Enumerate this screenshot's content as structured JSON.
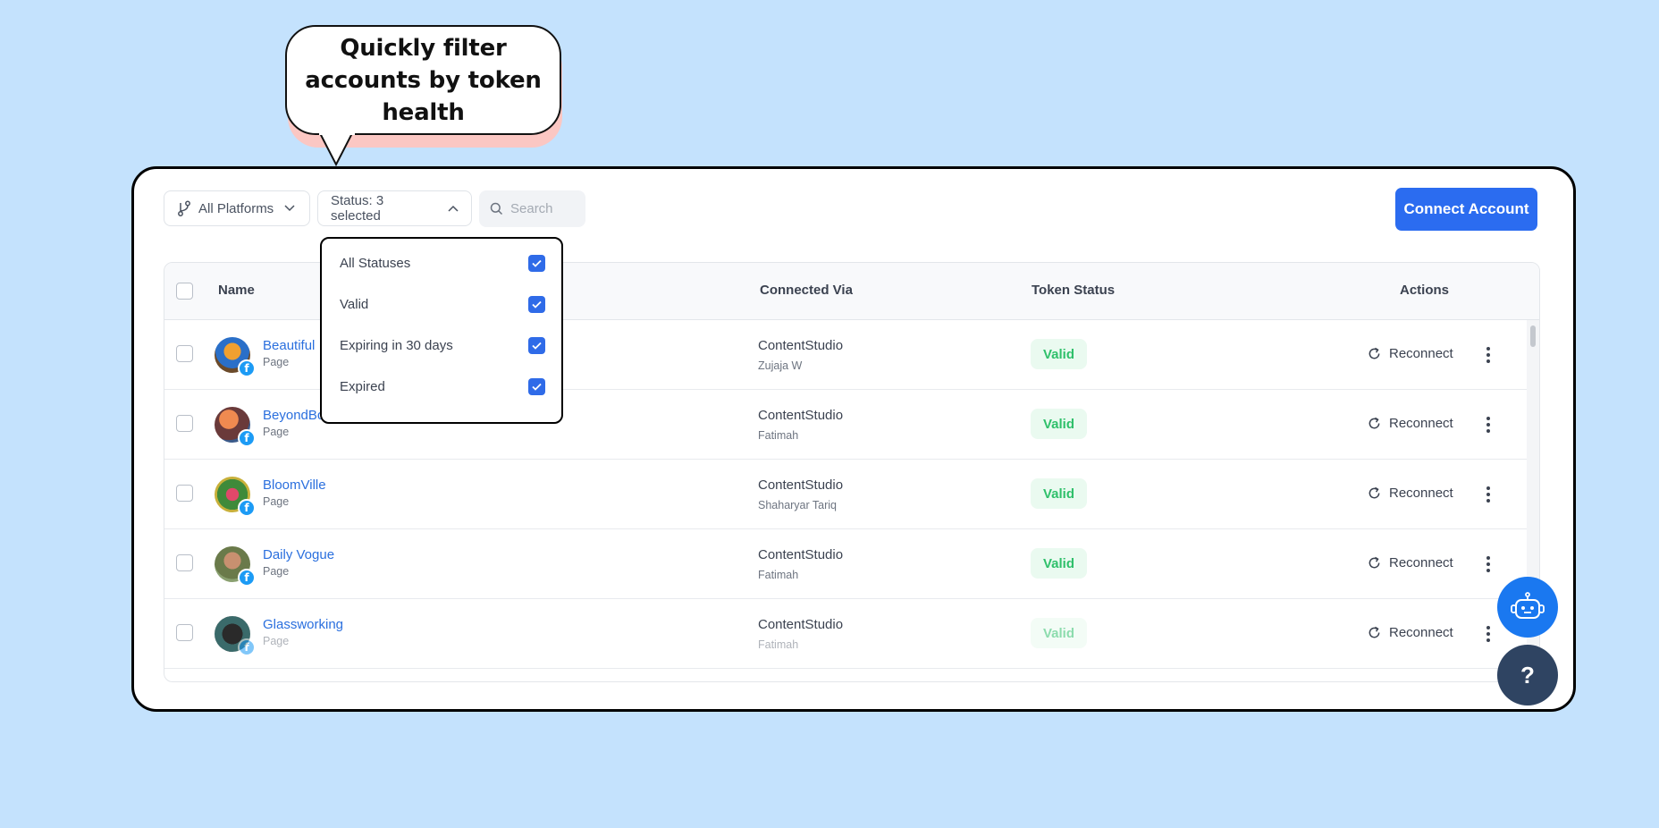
{
  "callout": {
    "text": "Quickly filter accounts by token health"
  },
  "toolbar": {
    "platforms_label": "All Platforms",
    "status_label": "Status: 3 selected",
    "search_placeholder": "Search",
    "connect_label": "Connect Account"
  },
  "status_dropdown": {
    "options": [
      {
        "label": "All Statuses",
        "checked": true
      },
      {
        "label": "Valid",
        "checked": true
      },
      {
        "label": "Expiring in 30 days",
        "checked": true
      },
      {
        "label": "Expired",
        "checked": true
      }
    ]
  },
  "table": {
    "headers": {
      "name": "Name",
      "connected_via": "Connected Via",
      "token_status": "Token Status",
      "actions": "Actions"
    },
    "rows": [
      {
        "name": "Beautiful",
        "type": "Page",
        "via": "ContentStudio",
        "user": "Zujaja W",
        "status": "Valid",
        "action": "Reconnect"
      },
      {
        "name": "BeyondBo",
        "type": "Page",
        "via": "ContentStudio",
        "user": "Fatimah",
        "status": "Valid",
        "action": "Reconnect"
      },
      {
        "name": "BloomVille",
        "type": "Page",
        "via": "ContentStudio",
        "user": "Shaharyar Tariq",
        "status": "Valid",
        "action": "Reconnect"
      },
      {
        "name": "Daily Vogue",
        "type": "Page",
        "via": "ContentStudio",
        "user": "Fatimah",
        "status": "Valid",
        "action": "Reconnect"
      },
      {
        "name": "Glassworking",
        "type": "Page",
        "via": "ContentStudio",
        "user": "Fatimah",
        "status": "Valid",
        "action": "Reconnect"
      }
    ]
  },
  "platform_icon": "facebook-icon",
  "help_label": "?",
  "colors": {
    "accent": "#2b6cf0",
    "valid": "#2fc06b",
    "background": "#c4e2fd"
  }
}
